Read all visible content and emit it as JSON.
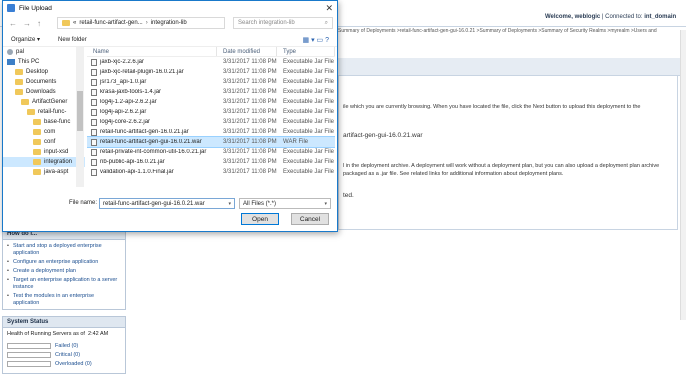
{
  "console": {
    "welcome_label": "Welcome, weblogic",
    "connected_label": "Connected to:",
    "domain": "int_domain",
    "breadcrumbs": "Summary of Deployments >retail-func-artifact-gen-gui-16.0.21 >Summary of Deployments >Summary of Security Realms >myrealm >Users and",
    "text1": "ile which you are currently browsing. When you have located the file, click the Next button to upload this deployment to the",
    "text2": "artifact-gen-gui-16.0.21.war",
    "text3": "l in the deployment archive. A deployment will work without a deployment plan, but you can also upload a deployment plan archive",
    "text4": "packaged as a .jar file. See related links for additional information about deployment plans.",
    "text5": "ted."
  },
  "howdoi": {
    "title": "How do I...",
    "items": [
      "Start and stop a deployed enterprise application",
      "Configure an enterprise application",
      "Create a deployment plan",
      "Target an enterprise application to a server instance",
      "Test the modules in an enterprise application"
    ]
  },
  "system_status": {
    "title": "System Status",
    "health_label": "Health of Running Servers as of",
    "time": "2:42 AM",
    "rows": [
      "Failed (0)",
      "Critical (0)",
      "Overloaded (0)"
    ]
  },
  "dialog": {
    "title": "File Upload",
    "path": [
      "«",
      "retail-func-artifact-gen...",
      "integration-lib"
    ],
    "search_placeholder": "Search integration-lib",
    "organize_label": "Organize ▾",
    "new_folder_label": "New folder",
    "nav_items": [
      {
        "label": "pal",
        "type": "user",
        "indent": 4
      },
      {
        "label": "This PC",
        "type": "pc",
        "indent": 4
      },
      {
        "label": "Desktop",
        "type": "folder",
        "indent": 12
      },
      {
        "label": "Documents",
        "type": "folder",
        "indent": 12
      },
      {
        "label": "Downloads",
        "type": "folder",
        "indent": 12
      },
      {
        "label": "ArtifactGener",
        "type": "folder",
        "indent": 18
      },
      {
        "label": "retail-func-",
        "type": "folder",
        "indent": 24
      },
      {
        "label": "base-func",
        "type": "folder",
        "indent": 30
      },
      {
        "label": "com",
        "type": "folder",
        "indent": 30
      },
      {
        "label": "conf",
        "type": "folder",
        "indent": 30
      },
      {
        "label": "input-xsd",
        "type": "folder",
        "indent": 30
      },
      {
        "label": "integration",
        "type": "folder",
        "indent": 30,
        "selected": true
      },
      {
        "label": "java-aspt",
        "type": "folder",
        "indent": 30
      }
    ],
    "columns": [
      "Name",
      "Date modified",
      "Type"
    ],
    "files": [
      {
        "name": "jaxb-xjc-2.2.6.jar",
        "date": "3/31/2017 11:08 PM",
        "type": "Executable Jar File"
      },
      {
        "name": "jaxb-xjc-retail-plugin-16.0.21.jar",
        "date": "3/31/2017 11:08 PM",
        "type": "Executable Jar File"
      },
      {
        "name": "jsr173_api-1.0.jar",
        "date": "3/31/2017 11:08 PM",
        "type": "Executable Jar File"
      },
      {
        "name": "krasa-jaxb-tools-1.4.jar",
        "date": "3/31/2017 11:08 PM",
        "type": "Executable Jar File"
      },
      {
        "name": "log4j-1.2-api-2.6.2.jar",
        "date": "3/31/2017 11:08 PM",
        "type": "Executable Jar File"
      },
      {
        "name": "log4j-api-2.6.2.jar",
        "date": "3/31/2017 11:08 PM",
        "type": "Executable Jar File"
      },
      {
        "name": "log4j-core-2.6.2.jar",
        "date": "3/31/2017 11:08 PM",
        "type": "Executable Jar File"
      },
      {
        "name": "retail-func-artifact-gen-16.0.21.jar",
        "date": "3/31/2017 11:08 PM",
        "type": "Executable Jar File"
      },
      {
        "name": "retail-func-artifact-gen-gui-16.0.21.war",
        "date": "3/31/2017 11:08 PM",
        "type": "WAR File",
        "selected": true
      },
      {
        "name": "retail-private-int-common-util-16.0.21.jar",
        "date": "3/31/2017 11:08 PM",
        "type": "Executable Jar File"
      },
      {
        "name": "rib-public-api-16.0.21.jar",
        "date": "3/31/2017 11:08 PM",
        "type": "Executable Jar File"
      },
      {
        "name": "validation-api-1.1.0.Final.jar",
        "date": "3/31/2017 11:08 PM",
        "type": "Executable Jar File"
      }
    ],
    "filename_label": "File name:",
    "filename_value": "retail-func-artifact-gen-gui-16.0.21.war",
    "filter_value": "All Files (*.*)",
    "open_label": "Open",
    "cancel_label": "Cancel"
  }
}
